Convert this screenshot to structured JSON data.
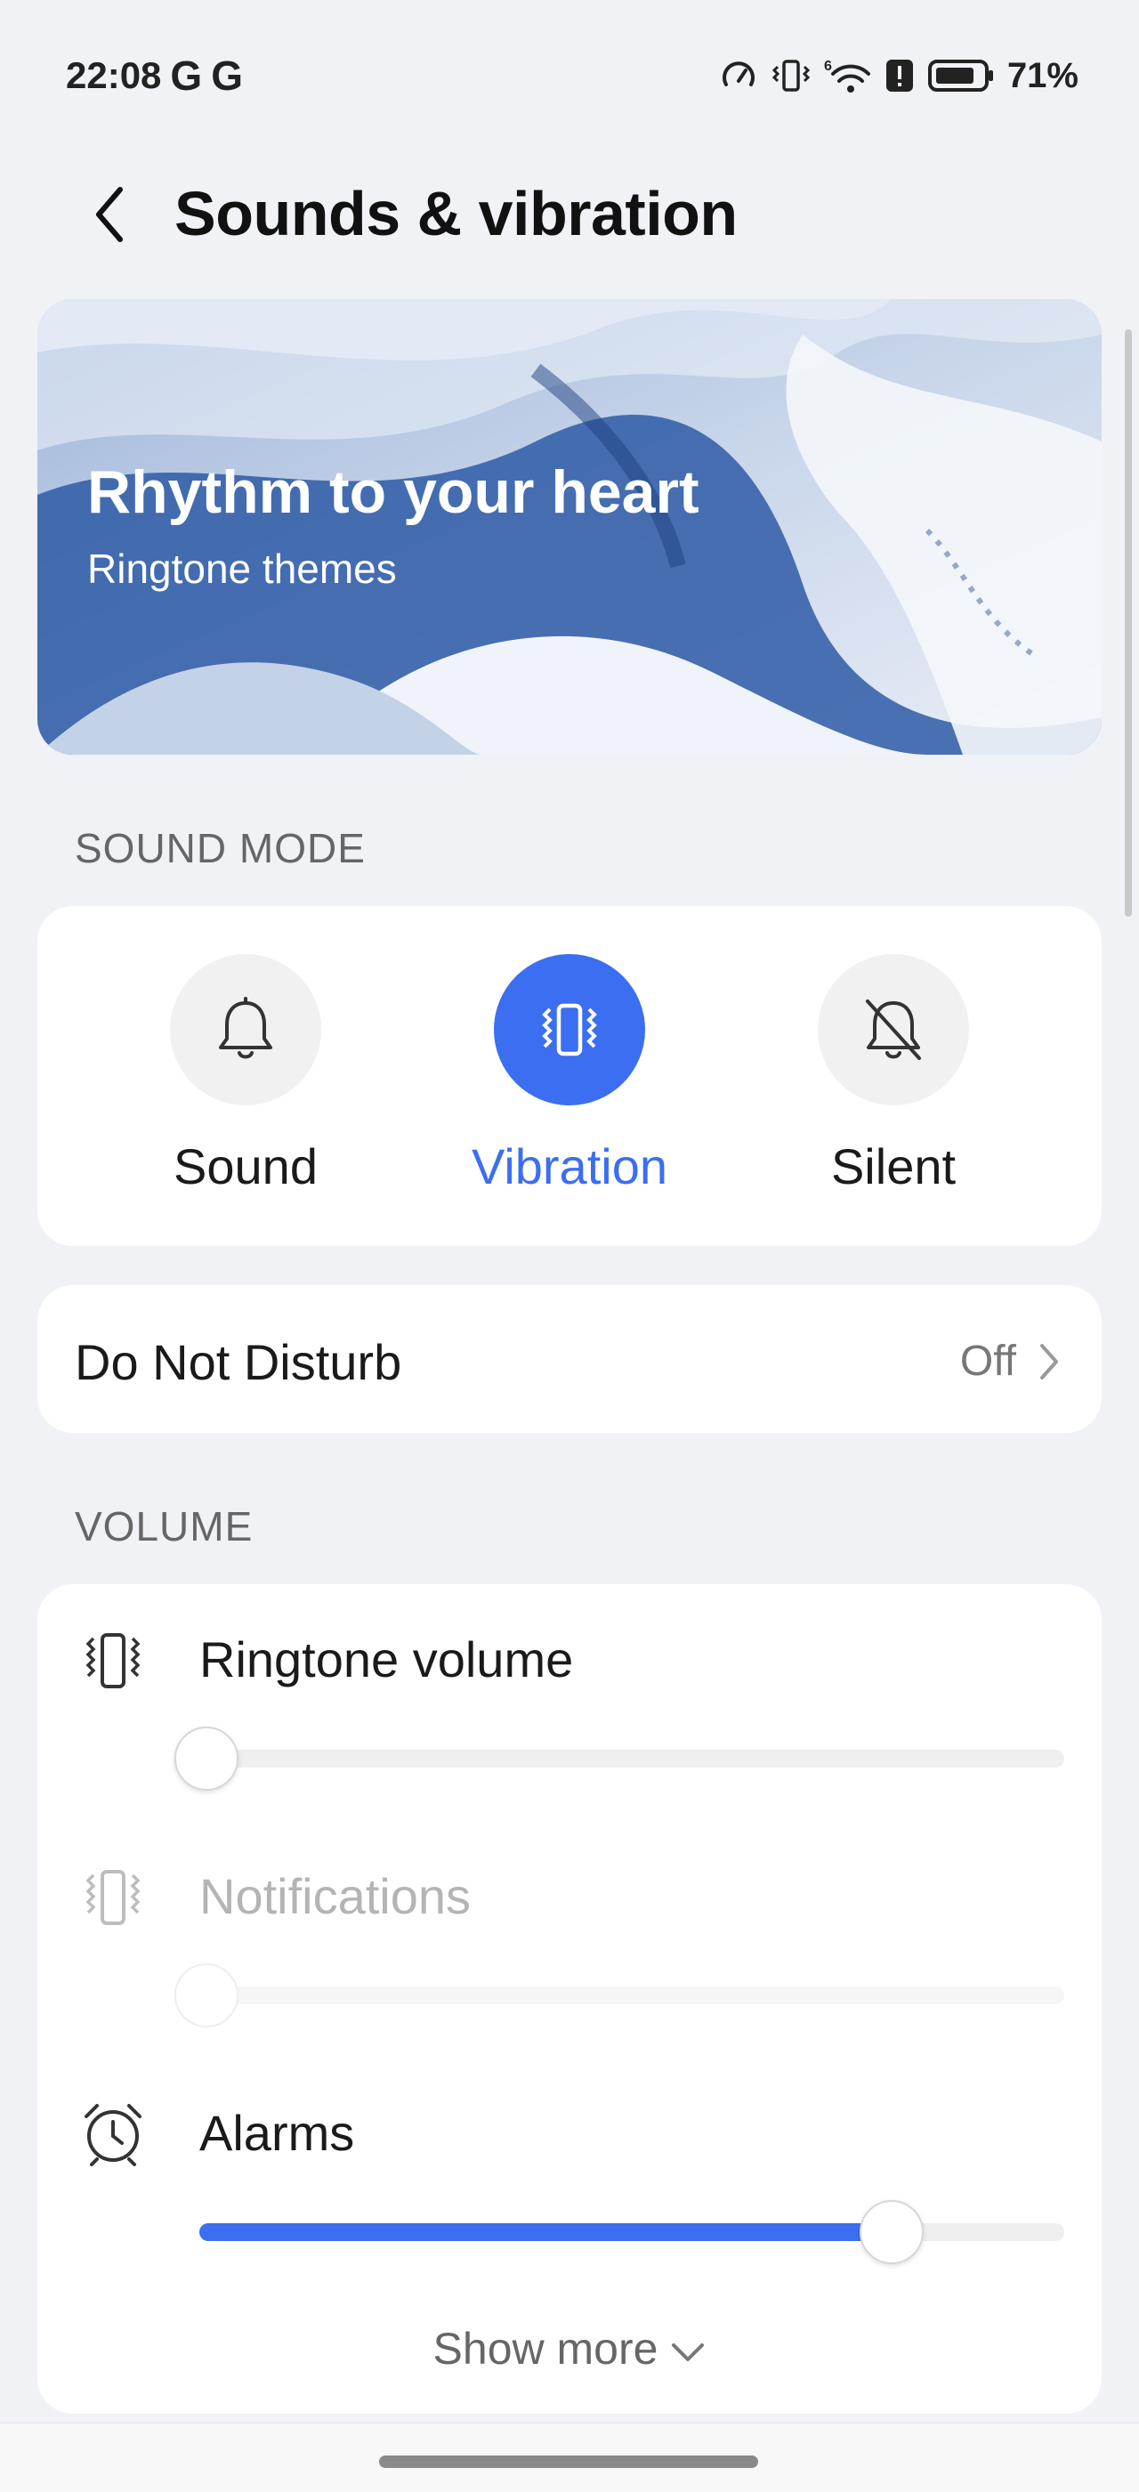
{
  "status_bar": {
    "time": "22:08",
    "notif_icons": [
      "google-g-icon",
      "google-g-icon"
    ],
    "battery_percent": "71%",
    "sys_icons": [
      "speed-icon",
      "vibrate-icon",
      "wifi-6-icon",
      "alert-icon",
      "battery-icon"
    ]
  },
  "header": {
    "title": "Sounds & vibration",
    "back_icon": "chevron-left-icon"
  },
  "banner": {
    "title": "Rhythm to your heart",
    "subtitle": "Ringtone themes"
  },
  "sound_mode": {
    "section_label": "SOUND MODE",
    "modes": [
      {
        "label": "Sound",
        "icon": "bell-icon",
        "selected": false
      },
      {
        "label": "Vibration",
        "icon": "vibrate-icon",
        "selected": true
      },
      {
        "label": "Silent",
        "icon": "bell-off-icon",
        "selected": false
      }
    ],
    "accent": "#3b6ef0"
  },
  "dnd": {
    "label": "Do Not Disturb",
    "value": "Off"
  },
  "volume": {
    "section_label": "VOLUME",
    "rows": [
      {
        "label": "Ringtone volume",
        "icon": "vibrate-icon",
        "level": 0.0,
        "enabled": true
      },
      {
        "label": "Notifications",
        "icon": "vibrate-icon",
        "level": 0.0,
        "enabled": false
      },
      {
        "label": "Alarms",
        "icon": "alarm-clock-icon",
        "level": 0.8,
        "enabled": true
      }
    ],
    "show_more": "Show more"
  }
}
